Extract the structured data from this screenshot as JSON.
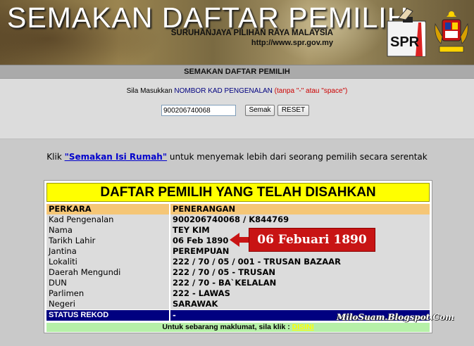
{
  "banner": {
    "title": "SEMAKAN DAFTAR PEMILIH",
    "subtitle": "SURUHANJAYA PILIHAN RAYA MALAYSIA",
    "url": "http://www.spr.gov.my",
    "logo_text": "SPR"
  },
  "subheader": "SEMAKAN DAFTAR PEMILIH",
  "form": {
    "instruction_prefix": "Sila Masukkan ",
    "instruction_highlight": "NOMBOR KAD PENGENALAN",
    "instruction_note": " (tanpa \"-\" atau \"space\")",
    "ic_value": "900206740068",
    "search_label": "Semak",
    "reset_label": "RESET"
  },
  "klik": {
    "prefix": "Klik ",
    "link": "\"Semakan Isi Rumah\"",
    "suffix": " untuk menyemak lebih dari seorang pemilih secara serentak"
  },
  "result": {
    "title": "DAFTAR PEMILIH YANG TELAH DISAHKAN",
    "header": {
      "col1": "PERKARA",
      "col2": "PENERANGAN"
    },
    "rows": [
      {
        "label": "Kad Pengenalan",
        "value": "900206740068 / K844769"
      },
      {
        "label": "Nama",
        "value": "TEY KIM"
      },
      {
        "label": "Tarikh Lahir",
        "value": "06 Feb 1890"
      },
      {
        "label": "Jantina",
        "value": "PEREMPUAN"
      },
      {
        "label": "Lokaliti",
        "value": "222 / 70 / 05 / 001 - TRUSAN BAZAAR"
      },
      {
        "label": "Daerah Mengundi",
        "value": "222 / 70 / 05 - TRUSAN"
      },
      {
        "label": "DUN",
        "value": "222 / 70 - BA`KELALAN"
      },
      {
        "label": "Parlimen",
        "value": "222 - LAWAS"
      },
      {
        "label": "Negeri",
        "value": "SARAWAK"
      }
    ],
    "status": {
      "label": "STATUS REKOD",
      "value": "-"
    },
    "footer_text": "Untuk sebarang maklumat, sila klik : ",
    "footer_link": "DISINI"
  },
  "annotation": "06 Febuari 1890",
  "watermark": "MiloSuam.Blogspot.Com",
  "colors": {
    "title_bar": "#ffff00",
    "header_row": "#f5c676",
    "status_row": "#000080",
    "footer_row": "#b6f0a8",
    "annotation": "#c81414"
  }
}
